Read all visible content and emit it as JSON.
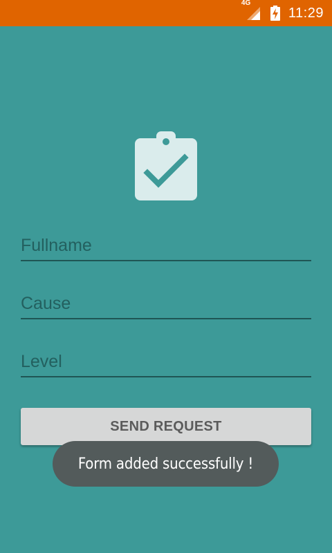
{
  "status_bar": {
    "network_type": "4G",
    "clock": "11:29",
    "icons": [
      "signal-icon",
      "battery-charging-icon"
    ],
    "color": "#e06400"
  },
  "app": {
    "background_color": "#3d9a98",
    "header_icon": "clipboard-check-icon"
  },
  "form": {
    "fullname": {
      "placeholder": "Fullname",
      "value": ""
    },
    "cause": {
      "placeholder": "Cause",
      "value": ""
    },
    "level": {
      "placeholder": "Level",
      "value": ""
    },
    "submit_label": "SEND REQUEST"
  },
  "toast": {
    "message": "Form added successfully !"
  }
}
